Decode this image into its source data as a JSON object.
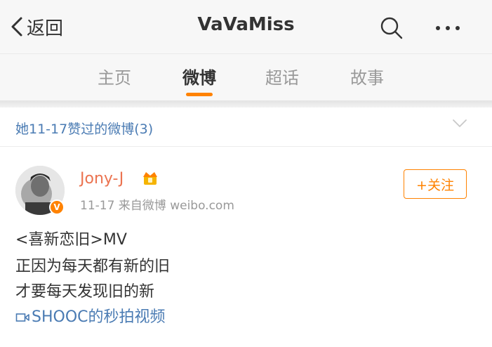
{
  "nav": {
    "back_label": "返回",
    "title": "VaVaMiss",
    "search_icon": "search-icon",
    "more_icon": "more-icon"
  },
  "tabs": [
    {
      "label": "主页",
      "active": false
    },
    {
      "label": "微博",
      "active": true
    },
    {
      "label": "超话",
      "active": false
    },
    {
      "label": "故事",
      "active": false
    }
  ],
  "filter": {
    "label": "她11-17赞过的微博(3)",
    "icon": "chevron-down-icon"
  },
  "post": {
    "username": "Jony-J",
    "meta": "11-17  来自微博 weibo.com",
    "verified_badge": "V",
    "follow_label": "+关注",
    "lines": [
      "<喜新恋旧>MV",
      "正因为每天都有新的旧",
      "才要每天发现旧的新"
    ],
    "video_link": "SHOOC的秒拍视频"
  },
  "colors": {
    "accent": "#ff8200",
    "link": "#4a7bb3",
    "username": "#eb7350",
    "nav_bg": "#f7f7f7"
  }
}
